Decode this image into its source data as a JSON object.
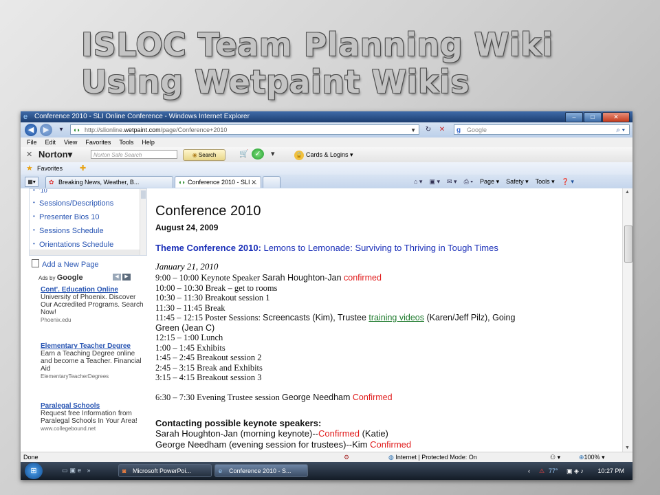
{
  "slide": {
    "title_line1": "ISLOC Team Planning Wiki",
    "title_line2": "Using Wetpaint Wikis"
  },
  "window": {
    "title": "Conference 2010 - SLI Online Conference - Windows Internet Explorer"
  },
  "address": {
    "prefix": "http://slionline.",
    "domain": "wetpaint.com",
    "path": "/page/Conference+2010",
    "search_placeholder": "Google"
  },
  "menu": [
    "File",
    "Edit",
    "View",
    "Favorites",
    "Tools",
    "Help"
  ],
  "norton": {
    "brand": "Norton",
    "search_placeholder": "Norton Safe Search",
    "search_button": "Search",
    "cards_label": "Cards & Logins"
  },
  "favorites": {
    "label": "Favorites"
  },
  "tabs": [
    {
      "label": "Breaking News, Weather, B..."
    },
    {
      "label": "Conference 2010 - SLI ..."
    }
  ],
  "commands": {
    "page": "Page",
    "safety": "Safety",
    "tools": "Tools"
  },
  "sidebar": {
    "nav_partial": "'10",
    "nav_items": [
      "Sessions/Descriptions",
      "Presenter Bios 10",
      "Sessions Schedule",
      "Orientations Schedule"
    ],
    "add_page": "Add a New Page",
    "ads_by": "Ads by",
    "ads_brand": "Google",
    "ads": [
      {
        "title": "Cont'. Education Online",
        "body": "University of Phoenix. Discover Our Accredited Programs. Search Now!",
        "url": "Phoenix.edu"
      },
      {
        "title": "Elementary Teacher Degree",
        "body": "Earn a Teaching Degree online and become a Teacher. Financial Aid",
        "url": "ElementaryTeacherDegrees"
      },
      {
        "title": "Paralegal Schools",
        "body": "Request free Information from Paralegal Schools In Your Area!",
        "url": "www.collegebound.net"
      }
    ]
  },
  "content": {
    "title": "Conference 2010",
    "date": "August 24, 2009",
    "theme_label": "Theme Conference 2010:",
    "theme_text": " Lemons to Lemonade: Surviving to Thriving in Tough Times",
    "schedule_date": "January 21, 2010",
    "schedule": {
      "r1_time": "9:00 – 10:00 Keynote Speaker ",
      "r1_name": "Sarah Houghton-Jan ",
      "r1_status": "confirmed",
      "r2": "10:00 – 10:30 Break – get to rooms",
      "r3": "10:30 – 11:30 Breakout session 1",
      "r4": "11:30 – 11:45 Break",
      "r5_time": "11:45 – 12:15 Poster Sessions: ",
      "r5_a": "Screencasts (Kim), Trustee ",
      "r5_link": "training videos",
      "r5_b": " (Karen/Jeff Pilz), Going",
      "r5_c": "Green (Jean C)",
      "r6": "12:15 – 1:00 Lunch",
      "r7": "1:00 – 1:45 Exhibits",
      "r8": "1:45 – 2:45 Breakout session 2",
      "r9": "2:45 – 3:15 Break and Exhibits",
      "r10": "3:15 – 4:15 Breakout session 3",
      "r11_time": "6:30 – 7:30 Evening Trustee session ",
      "r11_name": "George Needham ",
      "r11_status": "Confirmed"
    },
    "contacting_heading": "Contacting possible keynote speakers:",
    "contact1_a": "Sarah Houghton-Jan (morning keynote)--",
    "contact1_status": "Confirmed",
    "contact1_b": " (Katie)",
    "contact2_a": "George Needham (evening session for trustees)--Kim ",
    "contact2_status": "Confirmed"
  },
  "status": {
    "left": "Done",
    "zone": "Internet | Protected Mode: On",
    "zoom": "100%"
  },
  "taskbar": {
    "items": [
      "Microsoft PowerPoi...",
      "Conference 2010 - S..."
    ],
    "temp": "77°",
    "clock": "10:27 PM"
  }
}
